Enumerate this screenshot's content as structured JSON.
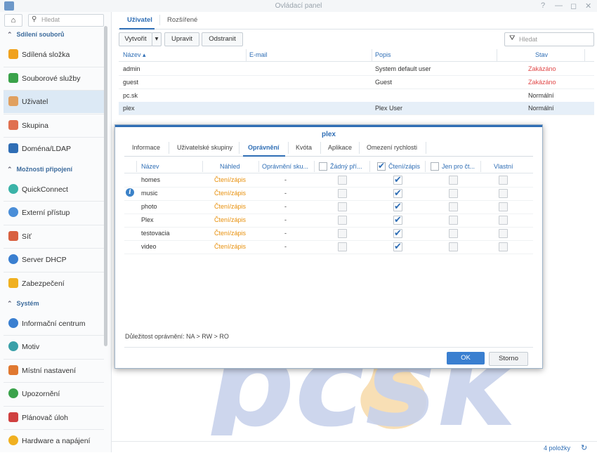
{
  "window": {
    "title": "Ovládací panel",
    "help_glyph": "?",
    "min_glyph": "—",
    "max_glyph": "◻",
    "close_glyph": "✕"
  },
  "sidebar": {
    "search_placeholder": "Hledat",
    "sections": {
      "file_sharing": "Sdílení souborů",
      "connectivity": "Možnosti připojení",
      "system": "Systém"
    },
    "items": [
      {
        "label": "Sdílená složka",
        "icon": "shared-folder-icon",
        "color": "#f0a21e"
      },
      {
        "label": "Souborové služby",
        "icon": "file-services-icon",
        "color": "#3aa24a"
      },
      {
        "label": "Uživatel",
        "icon": "user-icon",
        "color": "#e0a060"
      },
      {
        "label": "Skupina",
        "icon": "group-icon",
        "color": "#e07050"
      },
      {
        "label": "Doména/LDAP",
        "icon": "domain-icon",
        "color": "#2f6eb5"
      },
      {
        "label": "QuickConnect",
        "icon": "quickconnect-icon",
        "color": "#3bb3a8"
      },
      {
        "label": "Externí přístup",
        "icon": "external-access-icon",
        "color": "#4a8ed8"
      },
      {
        "label": "Síť",
        "icon": "network-icon",
        "color": "#d86040"
      },
      {
        "label": "Server DHCP",
        "icon": "dhcp-icon",
        "color": "#3a7fd0"
      },
      {
        "label": "Zabezpečení",
        "icon": "security-icon",
        "color": "#f0b020"
      },
      {
        "label": "Informační centrum",
        "icon": "info-center-icon",
        "color": "#3a7fd0"
      },
      {
        "label": "Motiv",
        "icon": "theme-icon",
        "color": "#3aa0a8"
      },
      {
        "label": "Místní nastavení",
        "icon": "regional-icon",
        "color": "#e07830"
      },
      {
        "label": "Upozornění",
        "icon": "notification-icon",
        "color": "#3aa24a"
      },
      {
        "label": "Plánovač úloh",
        "icon": "task-scheduler-icon",
        "color": "#d04040"
      },
      {
        "label": "Hardware a napájení",
        "icon": "hardware-icon",
        "color": "#f0b020"
      }
    ]
  },
  "main": {
    "tabs": [
      "Uživatel",
      "Rozšířené"
    ],
    "toolbar": {
      "create": "Vytvořit",
      "create_arrow": "▾",
      "edit": "Upravit",
      "delete": "Odstranit",
      "filter_placeholder": "Hledat"
    },
    "user_table": {
      "headers": [
        "Název ▴",
        "E-mail",
        "Popis",
        "Stav"
      ],
      "rows": [
        {
          "name": "admin",
          "email": "",
          "desc": "System default user",
          "status": "Zakázáno"
        },
        {
          "name": "guest",
          "email": "",
          "desc": "Guest",
          "status": "Zakázáno"
        },
        {
          "name": "pc.sk",
          "email": "",
          "desc": "",
          "status": "Normální"
        },
        {
          "name": "plex",
          "email": "",
          "desc": "Plex User",
          "status": "Normální"
        }
      ]
    }
  },
  "dialog": {
    "title": "plex",
    "tabs": [
      "Informace",
      "Uživatelské skupiny",
      "Oprávnění",
      "Kvóta",
      "Aplikace",
      "Omezení rychlosti"
    ],
    "perm_headers": [
      "Název",
      "Náhled",
      "Oprávnění sku...",
      "Žádný pří...",
      "Čtení/zápis",
      "Jen pro čt...",
      "Vlastní"
    ],
    "rows": [
      {
        "name": "homes",
        "preview": "Čtení/zápis",
        "group": "-",
        "na": false,
        "rw": true,
        "ro": false,
        "custom": false
      },
      {
        "name": "music",
        "preview": "Čtení/zápis",
        "group": "-",
        "na": false,
        "rw": true,
        "ro": false,
        "custom": false
      },
      {
        "name": "photo",
        "preview": "Čtení/zápis",
        "group": "-",
        "na": false,
        "rw": true,
        "ro": false,
        "custom": false
      },
      {
        "name": "Plex",
        "preview": "Čtení/zápis",
        "group": "-",
        "na": false,
        "rw": true,
        "ro": false,
        "custom": false
      },
      {
        "name": "testovacia",
        "preview": "Čtení/zápis",
        "group": "-",
        "na": false,
        "rw": true,
        "ro": false,
        "custom": false
      },
      {
        "name": "video",
        "preview": "Čtení/zápis",
        "group": "-",
        "na": false,
        "rw": true,
        "ro": false,
        "custom": false
      }
    ],
    "priority_note": "Důležitost oprávnění: NA > RW > RO",
    "ok": "OK",
    "cancel": "Storno"
  },
  "watermark": {
    "text": "pcsk"
  },
  "footer": {
    "items_count": "4 položky",
    "refresh_glyph": "↻"
  },
  "colors": {
    "accent": "#2f6eb5",
    "disabled": "#e04848",
    "orange": "#e8900c",
    "watermark_blue": "#c8d2ec",
    "watermark_flame": "#f7d9a8"
  }
}
